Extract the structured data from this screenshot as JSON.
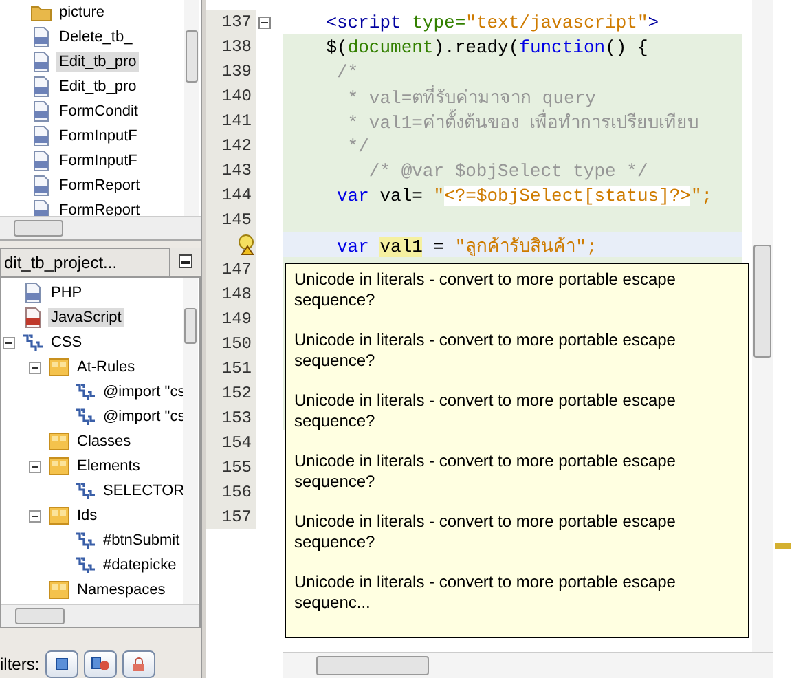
{
  "files_tree": {
    "items": [
      {
        "label": "picture",
        "kind": "folder",
        "selected": false
      },
      {
        "label": "Delete_tb_",
        "kind": "php",
        "selected": false
      },
      {
        "label": "Edit_tb_pro",
        "kind": "php",
        "selected": true
      },
      {
        "label": "Edit_tb_pro",
        "kind": "php",
        "selected": false
      },
      {
        "label": "FormCondit",
        "kind": "php",
        "selected": false
      },
      {
        "label": "FormInputF",
        "kind": "php",
        "selected": false
      },
      {
        "label": "FormInputF",
        "kind": "php",
        "selected": false
      },
      {
        "label": "FormReport",
        "kind": "php",
        "selected": false
      },
      {
        "label": "FormReport",
        "kind": "php",
        "selected": false
      }
    ]
  },
  "navigator": {
    "tab_title": "dit_tb_project...",
    "items": [
      {
        "label": "PHP",
        "kind": "php",
        "selected": false
      },
      {
        "label": "JavaScript",
        "kind": "js",
        "selected": true
      },
      {
        "label": "CSS",
        "kind": "css",
        "selected": false,
        "expanded": true,
        "children": [
          {
            "label": "At-Rules",
            "kind": "folder",
            "selected": false,
            "expanded": true,
            "children": [
              {
                "label": "@import \"cs",
                "kind": "css",
                "selected": false
              },
              {
                "label": "@import \"cs",
                "kind": "css",
                "selected": false
              }
            ]
          },
          {
            "label": "Classes",
            "kind": "folder",
            "selected": false
          },
          {
            "label": "Elements",
            "kind": "folder",
            "selected": false,
            "expanded": true,
            "children": [
              {
                "label": "SELECTOR",
                "kind": "css",
                "selected": false
              }
            ]
          },
          {
            "label": "Ids",
            "kind": "folder",
            "selected": false,
            "expanded": true,
            "children": [
              {
                "label": "#btnSubmit",
                "kind": "css",
                "selected": false
              },
              {
                "label": "#datepicke",
                "kind": "css",
                "selected": false
              }
            ]
          },
          {
            "label": "Namespaces",
            "kind": "folder",
            "selected": false
          }
        ]
      }
    ],
    "filters_label": "ilters:",
    "filters": [
      {
        "kind": "square",
        "on": false
      },
      {
        "kind": "static",
        "on": false
      },
      {
        "kind": "lock",
        "on": false
      }
    ]
  },
  "editor": {
    "lines": [
      {
        "number": "137",
        "embedded": false,
        "foldable": true,
        "segments": [
          {
            "text": "    <script ",
            "kind": "tag"
          },
          {
            "text": "type=",
            "kind": "attr"
          },
          {
            "text": "\"text/javascript\"",
            "kind": "str"
          },
          {
            "text": ">",
            "kind": "tag"
          }
        ]
      },
      {
        "number": "138",
        "embedded": true,
        "segments": [
          {
            "text": "    $(",
            "kind": "plain"
          },
          {
            "text": "document",
            "kind": "attr"
          },
          {
            "text": ").ready(",
            "kind": "plain"
          },
          {
            "text": "function",
            "kind": "kw"
          },
          {
            "text": "() {",
            "kind": "plain"
          }
        ]
      },
      {
        "number": "139",
        "embedded": true,
        "segments": [
          {
            "text": "     /*",
            "kind": "comment"
          }
        ]
      },
      {
        "number": "140",
        "embedded": true,
        "segments": [
          {
            "text": "      * val=ตที่รับค่ามาจาก query",
            "kind": "comment"
          }
        ]
      },
      {
        "number": "141",
        "embedded": true,
        "segments": [
          {
            "text": "      * val1=ค่าตั้งต้นของ เพื่อทำการเปรียบเทียบ",
            "kind": "comment"
          }
        ]
      },
      {
        "number": "142",
        "embedded": true,
        "segments": [
          {
            "text": "      */",
            "kind": "comment"
          }
        ]
      },
      {
        "number": "143",
        "embedded": true,
        "segments": [
          {
            "text": "        /* @var $objSelect type */",
            "kind": "comment"
          }
        ]
      },
      {
        "number": "144",
        "embedded": true,
        "segments": [
          {
            "text": "     var",
            "kind": "kw"
          },
          {
            "text": " val= ",
            "kind": "plain"
          },
          {
            "text": "\"",
            "kind": "str"
          },
          {
            "text": "<?=$objSelect[status]?>",
            "kind": "php"
          },
          {
            "text": "\";",
            "kind": "str"
          }
        ]
      },
      {
        "number": "145",
        "embedded": true
      },
      {
        "caret": true,
        "hint": true,
        "segments": [
          {
            "text": "     var ",
            "kind": "kw"
          },
          {
            "text": "val1",
            "kind": "mark"
          },
          {
            "text": " = ",
            "kind": "plain"
          },
          {
            "text": "\"ลูกค้ารับสินค้า\";",
            "kind": "str"
          }
        ]
      },
      {
        "number": "147",
        "embedded": true
      },
      {
        "number": "148",
        "embedded": true
      },
      {
        "number": "149",
        "embedded": true
      },
      {
        "number": "150",
        "embedded": true
      },
      {
        "number": "151",
        "embedded": true
      },
      {
        "number": "152",
        "embedded": true
      },
      {
        "number": "153",
        "embedded": true
      },
      {
        "number": "154",
        "embedded": false
      },
      {
        "number": "155",
        "embedded": false
      },
      {
        "number": "156",
        "embedded": false
      },
      {
        "number": "157",
        "embedded": false
      }
    ],
    "tooltip": {
      "messages": [
        "Unicode in literals - convert to more portable escape sequence?",
        "Unicode in literals - convert to more portable escape sequence?",
        "Unicode in literals - convert to more portable escape sequence?",
        "Unicode in literals - convert to more portable escape sequence?",
        "Unicode in literals - convert to more portable escape sequence?",
        "Unicode in literals - convert to more portable escape sequenc..."
      ]
    }
  }
}
